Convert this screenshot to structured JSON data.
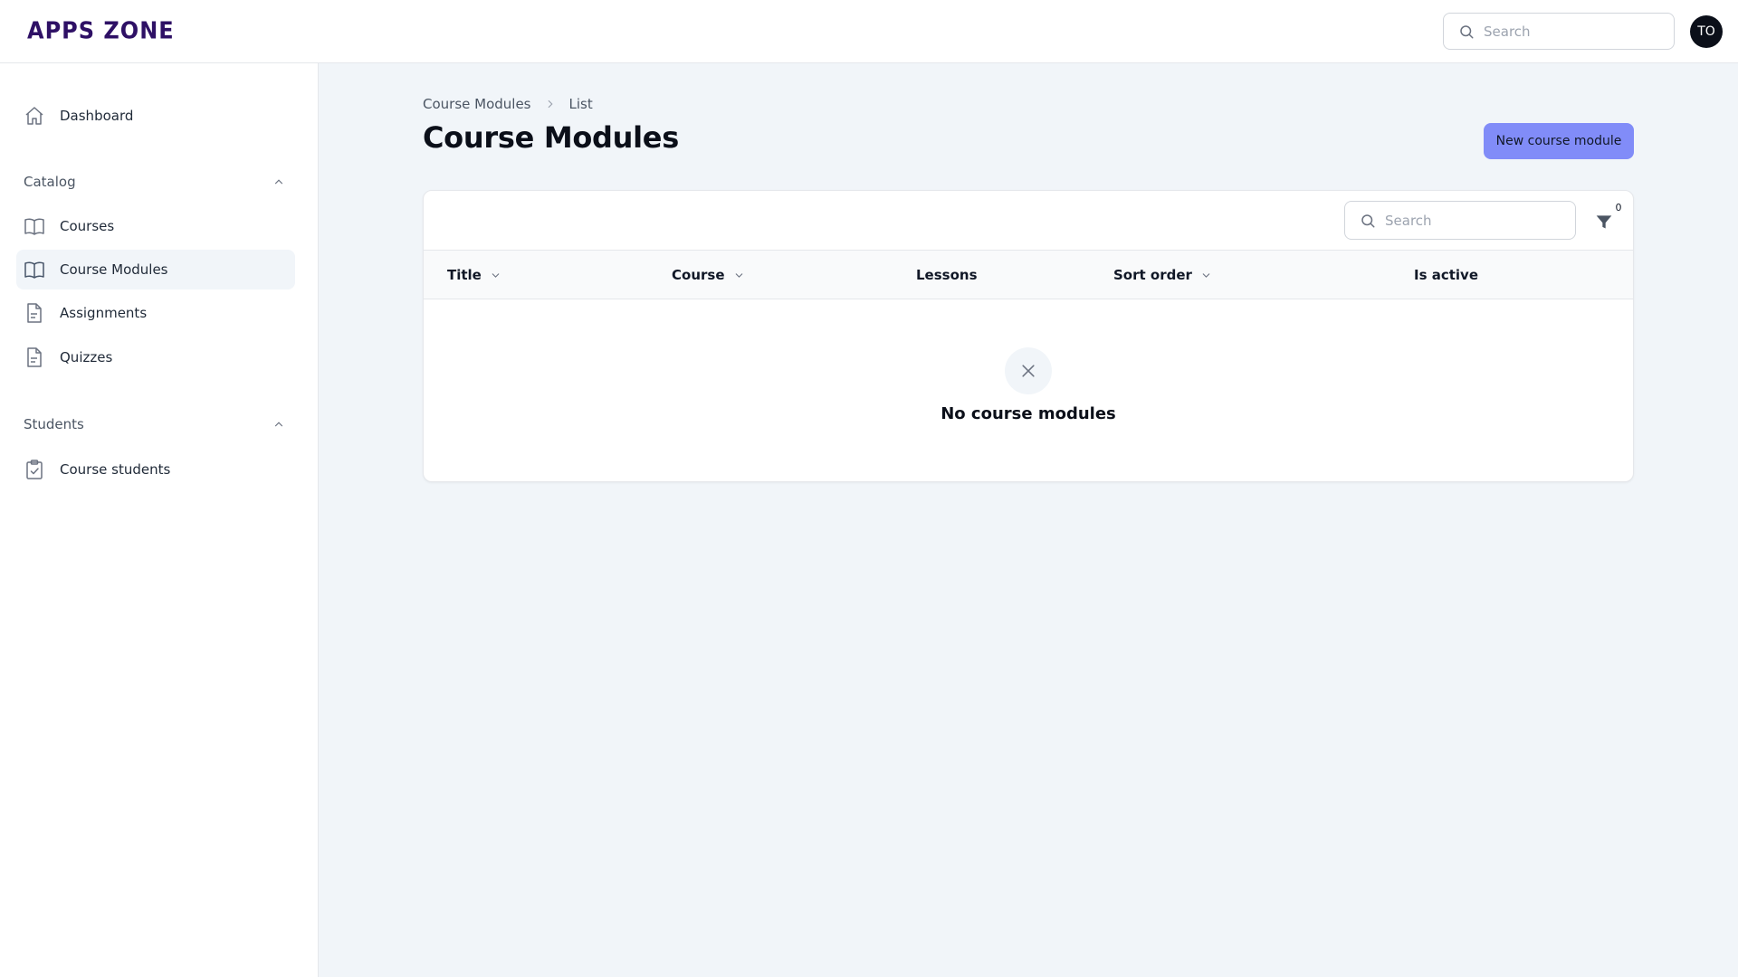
{
  "app": {
    "logo": "APPS ZONE"
  },
  "header": {
    "search_placeholder": "Search",
    "avatar_initials": "TO"
  },
  "sidebar": {
    "dashboard": "Dashboard",
    "groups": [
      {
        "label": "Catalog",
        "items": [
          "Courses",
          "Course Modules",
          "Assignments",
          "Quizzes"
        ]
      },
      {
        "label": "Students",
        "items": [
          "Course students"
        ]
      }
    ],
    "active_item": "Course Modules"
  },
  "breadcrumb": [
    "Course Modules",
    "List"
  ],
  "page": {
    "title": "Course Modules",
    "new_button": "New course module"
  },
  "table": {
    "search_placeholder": "Search",
    "filter_count": "0",
    "columns": [
      {
        "label": "Title",
        "sortable": true
      },
      {
        "label": "Course",
        "sortable": true
      },
      {
        "label": "Lessons",
        "sortable": false
      },
      {
        "label": "Sort order",
        "sortable": true
      },
      {
        "label": "Is active",
        "sortable": false
      }
    ],
    "empty_text": "No course modules"
  },
  "colors": {
    "accent": "#818cf8",
    "logo": "#2e1065",
    "background": "#f1f5f9"
  }
}
